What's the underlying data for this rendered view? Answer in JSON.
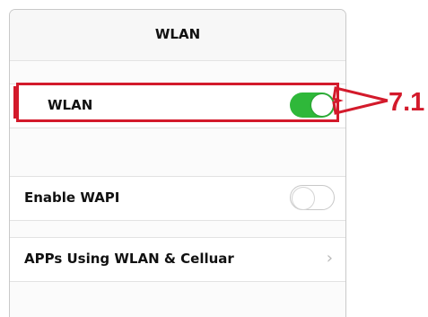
{
  "nav": {
    "title": "WLAN"
  },
  "rows": {
    "wlan": {
      "label": "WLAN",
      "toggle_on": true
    },
    "wapi": {
      "label": "Enable WAPI",
      "toggle_on": false
    },
    "apps": {
      "label": "APPs Using WLAN & Celluar",
      "chevron": "chevron-right-icon"
    }
  },
  "annotation": {
    "label": "7.1",
    "color": "#d31a2b"
  },
  "colors": {
    "toggle_on": "#2fb83a",
    "highlight": "#d31a2b"
  }
}
